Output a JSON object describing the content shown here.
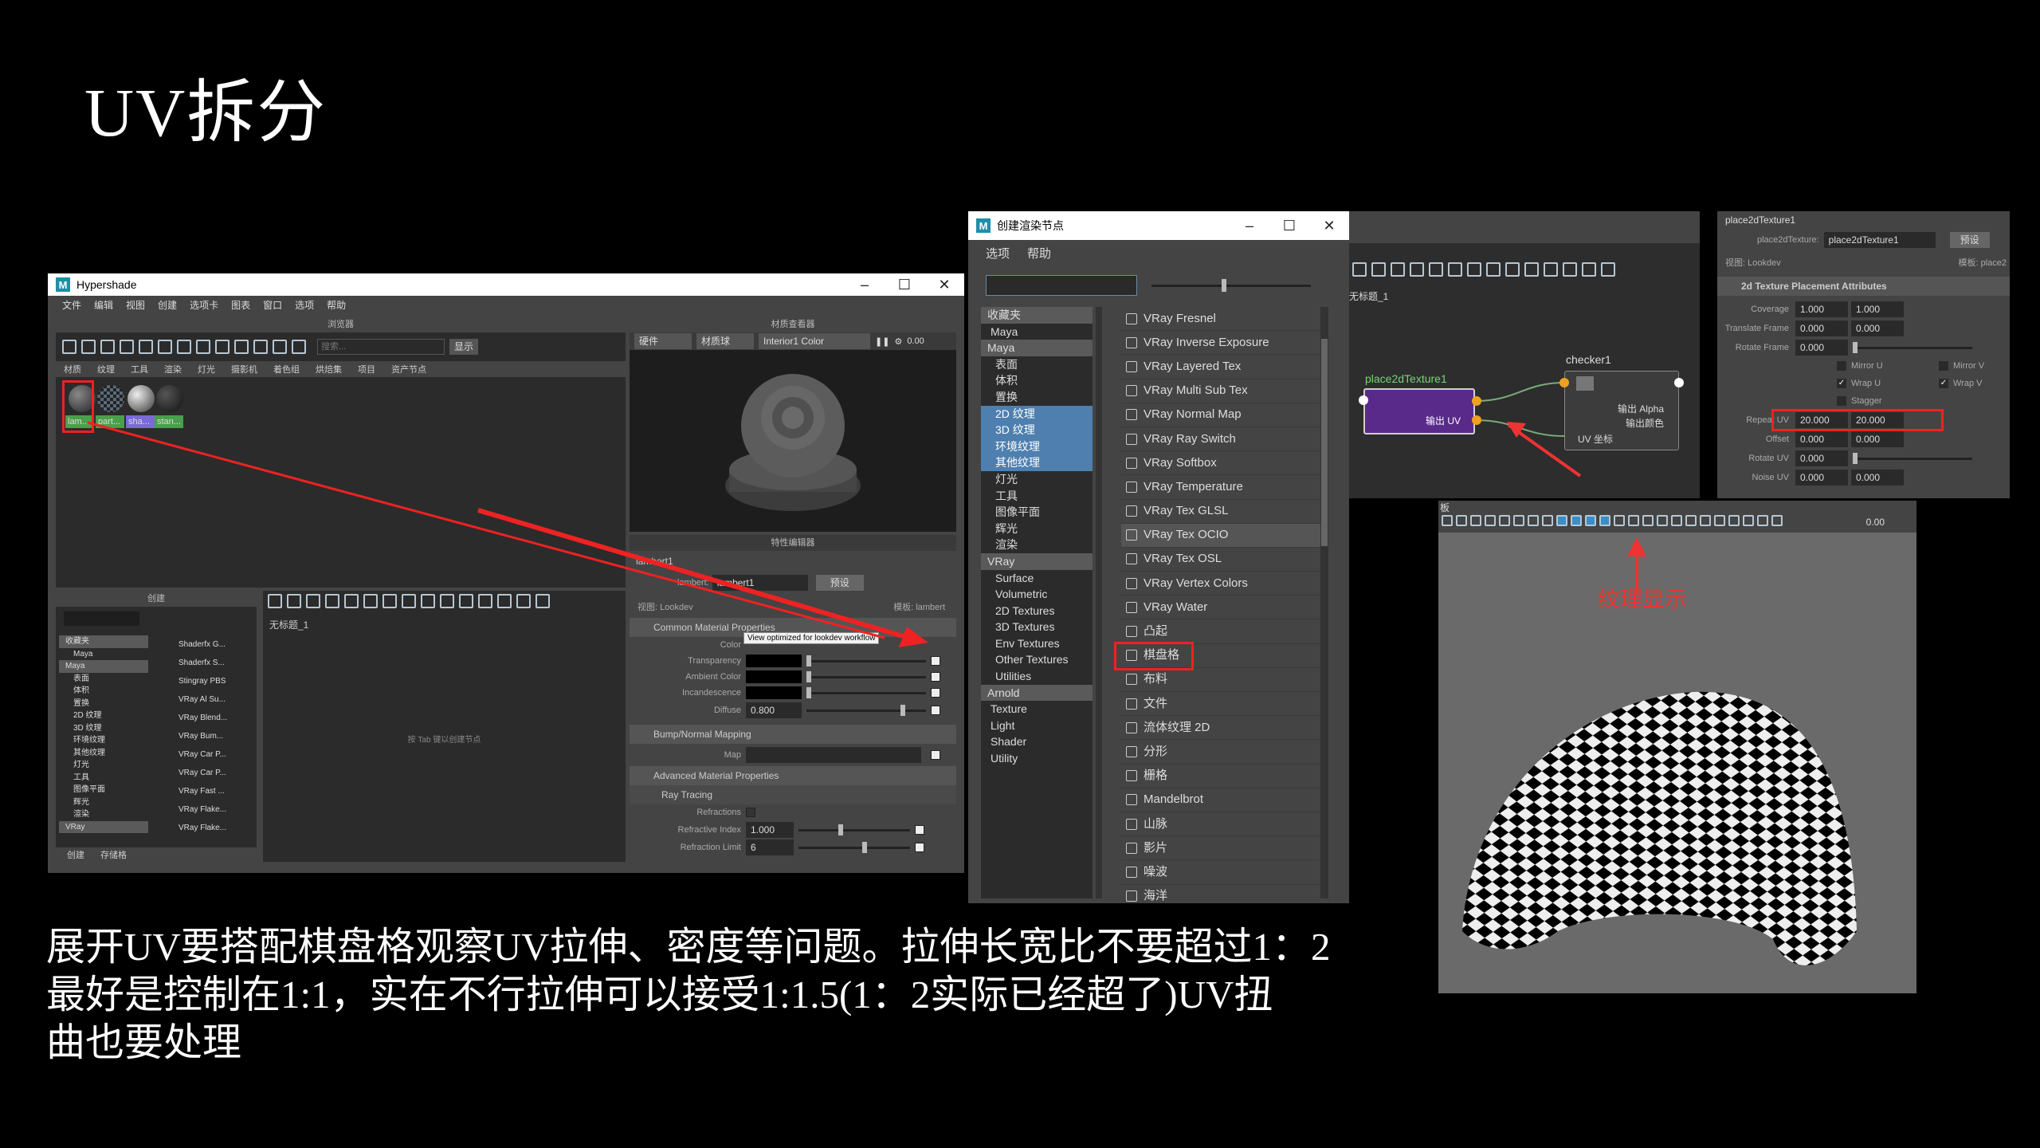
{
  "slide": {
    "title": "UV拆分",
    "caption": [
      "展开UV要搭配棋盘格观察UV拉伸、密度等问题。拉伸长宽比不要超过1：2",
      "最好是控制在1:1，实在不行拉伸可以接受1:1.5(1：2实际已经超了)UV扭",
      "曲也要处理"
    ]
  },
  "hypershade": {
    "title": "Hypershade",
    "menu": [
      "文件",
      "编辑",
      "视图",
      "创建",
      "选项卡",
      "图表",
      "窗口",
      "选项",
      "帮助"
    ],
    "browser_label": "浏览器",
    "search_placeholder": "搜索...",
    "show_button": "显示",
    "tabs": [
      "材质",
      "纹理",
      "工具",
      "渲染",
      "灯光",
      "摄影机",
      "着色组",
      "烘焙集",
      "项目",
      "资产节点"
    ],
    "materials": [
      "lam...",
      "part...",
      "sha...",
      "stan..."
    ],
    "viewer_label": "材质查看器",
    "viewer_mode": "硬件",
    "viewer_shape": "材质球",
    "viewer_env": "Interior1 Color",
    "viewer_zoom": "0.00",
    "create_label": "创建",
    "tree": [
      "收藏夹",
      "Maya",
      "Maya",
      "表面",
      "体积",
      "置换",
      "2D 纹理",
      "3D 纹理",
      "环境纹理",
      "其他纹理",
      "灯光",
      "工具",
      "图像平面",
      "辉光",
      "渲染",
      "VRay"
    ],
    "shader_list": [
      "Shaderfx G...",
      "Shaderfx S...",
      "Stingray PBS",
      "VRay Al Su...",
      "VRay Blend...",
      "VRay Bum...",
      "VRay Car P...",
      "VRay Car P...",
      "VRay Fast ...",
      "VRay Flake...",
      "VRay Flake..."
    ],
    "bottom_tabs": [
      "创建",
      "存储格"
    ],
    "graph_tab": "无标题_1",
    "graph_hint": "按 Tab 键以创建节点",
    "prop_label": "特性编辑器",
    "prop_node": "lambert1",
    "prop_type_label": "lambert:",
    "prop_type_value": "lambert1",
    "prop_preset": "预设",
    "prop_view": "视图: Lookdev",
    "prop_template": "模板: lambert",
    "sec_common": "Common Material Properties",
    "tooltip": "View optimized for lookdev workflow",
    "props": [
      {
        "label": "Color"
      },
      {
        "label": "Transparency"
      },
      {
        "label": "Ambient Color"
      },
      {
        "label": "Incandescence"
      },
      {
        "label": "Diffuse",
        "value": "0.800"
      }
    ],
    "sec_bump": "Bump/Normal Mapping",
    "map_label": "Map",
    "sec_adv": "Advanced Material Properties",
    "sec_ray": "Ray Tracing",
    "refractions": "Refractions",
    "ref_index_label": "Refractive Index",
    "ref_index_value": "1.000",
    "ref_limit_label": "Refraction Limit",
    "ref_limit_value": "6"
  },
  "create_node": {
    "title": "创建渲染节点",
    "menu": [
      "选项",
      "帮助"
    ],
    "tree": [
      {
        "t": "收藏夹",
        "k": "hdr"
      },
      {
        "t": "Maya",
        "k": "c"
      },
      {
        "t": "Maya",
        "k": "hdr"
      },
      {
        "t": "表面"
      },
      {
        "t": "体积"
      },
      {
        "t": "置换"
      },
      {
        "t": "2D 纹理",
        "k": "sel"
      },
      {
        "t": "3D 纹理",
        "k": "sel"
      },
      {
        "t": "环境纹理",
        "k": "sel"
      },
      {
        "t": "其他纹理",
        "k": "sel"
      },
      {
        "t": "灯光"
      },
      {
        "t": "工具"
      },
      {
        "t": "图像平面"
      },
      {
        "t": "辉光"
      },
      {
        "t": "渲染"
      },
      {
        "t": "VRay",
        "k": "hdr"
      },
      {
        "t": "Surface"
      },
      {
        "t": "Volumetric"
      },
      {
        "t": "2D Textures"
      },
      {
        "t": "3D Textures"
      },
      {
        "t": "Env Textures"
      },
      {
        "t": "Other Textures"
      },
      {
        "t": "Utilities"
      },
      {
        "t": "Arnold",
        "k": "hdr"
      },
      {
        "t": "Texture",
        "k": "c"
      },
      {
        "t": "Light",
        "k": "c"
      },
      {
        "t": "Shader",
        "k": "c"
      },
      {
        "t": "Utility",
        "k": "c"
      }
    ],
    "nodes": [
      "VRay Fresnel",
      "VRay Inverse Exposure",
      "VRay Layered Tex",
      "VRay Multi Sub Tex",
      "VRay Normal Map",
      "VRay Ray Switch",
      "VRay Softbox",
      "VRay Temperature",
      "VRay Tex GLSL",
      "VRay Tex OCIO",
      "VRay Tex OSL",
      "VRay Vertex Colors",
      "VRay Water",
      "凸起",
      "棋盘格",
      "布料",
      "文件",
      "流体纹理 2D",
      "分形",
      "栅格",
      "Mandelbrot",
      "山脉",
      "影片",
      "噪波",
      "海洋"
    ]
  },
  "node_editor": {
    "tab": "无标题_1",
    "place_node": "place2dTexture1",
    "place_port": "输出 UV",
    "checker_node": "checker1",
    "checker_ports": [
      "输出 Alpha",
      "输出颜色",
      "UV 坐标"
    ]
  },
  "attr_editor": {
    "node": "place2dTexture1",
    "type_label": "place2dTexture:",
    "type_value": "place2dTexture1",
    "preset": "预设",
    "view": "视图: Lookdev",
    "template": "模板: place2",
    "section": "2d Texture Placement Attributes",
    "rows": [
      {
        "label": "Coverage",
        "a": "1.000",
        "b": "1.000"
      },
      {
        "label": "Translate Frame",
        "a": "0.000",
        "b": "0.000"
      },
      {
        "label": "Rotate Frame",
        "a": "0.000"
      }
    ],
    "checks": [
      {
        "label": "Mirror U",
        "on": false,
        "label2": "Mirror V",
        "on2": false
      },
      {
        "label": "Wrap U",
        "on": true,
        "label2": "Wrap V",
        "on2": true
      },
      {
        "label": "Stagger",
        "on": false
      }
    ],
    "rows2": [
      {
        "label": "Repeat UV",
        "a": "20.000",
        "b": "20.000"
      },
      {
        "label": "Offset",
        "a": "0.000",
        "b": "0.000"
      },
      {
        "label": "Rotate UV",
        "a": "0.000"
      },
      {
        "label": "Noise UV",
        "a": "0.000",
        "b": "0.000"
      }
    ]
  },
  "viewport": {
    "corner": "板",
    "zoom": "0.00",
    "annotation": "纹理显示"
  }
}
